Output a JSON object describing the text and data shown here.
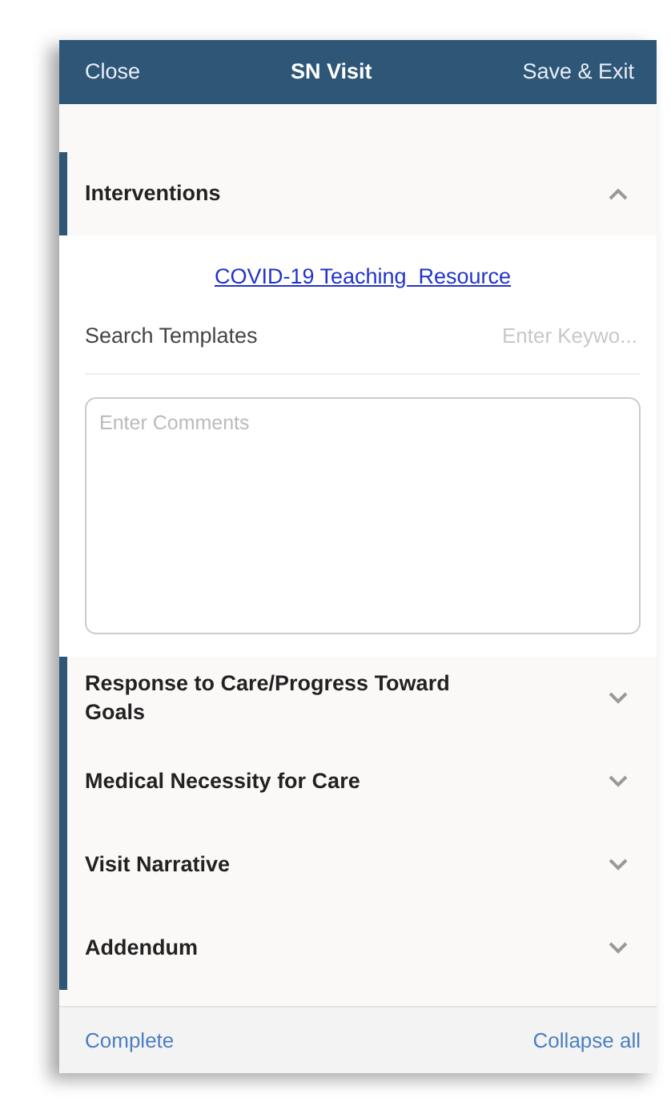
{
  "top_bar": {
    "left": "Close",
    "title": "SN Visit",
    "right": "Save & Exit"
  },
  "sections": [
    {
      "title": "Interventions",
      "expanded": true,
      "link": "COVID-19 Teaching  Resource",
      "search_label": "Search Templates",
      "search_placeholder": "Enter Keywo...",
      "comments_placeholder": "Enter Comments"
    },
    {
      "title": "Response to Care/Progress Toward Goals",
      "expanded": false
    },
    {
      "title": "Medical Necessity for Care",
      "expanded": false
    },
    {
      "title": "Visit Narrative",
      "expanded": false
    },
    {
      "title": "Addendum",
      "expanded": false
    }
  ],
  "footer": {
    "left": "Complete",
    "right": "Collapse all"
  }
}
